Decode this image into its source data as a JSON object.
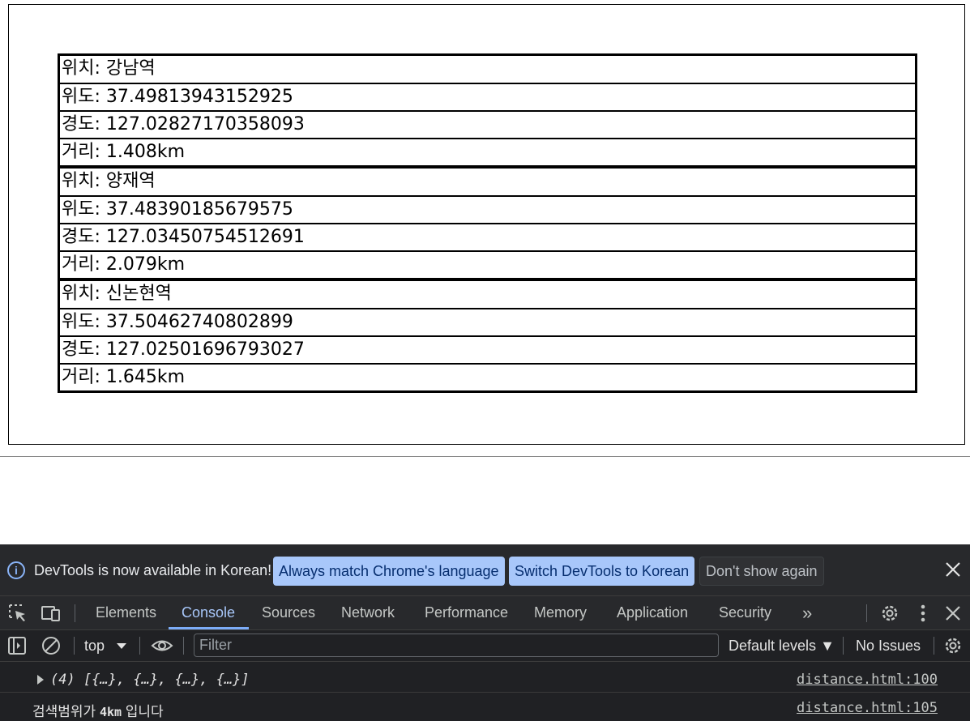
{
  "page": {
    "stations": [
      {
        "location": "위치: 강남역",
        "latitude": "위도: 37.49813943152925",
        "longitude": "경도: 127.02827170358093",
        "distance": "거리: 1.408km"
      },
      {
        "location": "위치: 양재역",
        "latitude": "위도: 37.48390185679575",
        "longitude": "경도: 127.03450754512691",
        "distance": "거리: 2.079km"
      },
      {
        "location": "위치: 신논현역",
        "latitude": "위도: 37.50462740802899",
        "longitude": "경도: 127.02501696793027",
        "distance": "거리: 1.645km"
      }
    ]
  },
  "devtools": {
    "infobar": {
      "message": "DevTools is now available in Korean!",
      "always_match": "Always match Chrome's language",
      "switch": "Switch DevTools to Korean",
      "dont_show": "Don't show again"
    },
    "tabs": [
      {
        "label": "Elements",
        "active": false
      },
      {
        "label": "Console",
        "active": true
      },
      {
        "label": "Sources",
        "active": false
      },
      {
        "label": "Network",
        "active": false
      },
      {
        "label": "Performance",
        "active": false
      },
      {
        "label": "Memory",
        "active": false
      },
      {
        "label": "Application",
        "active": false
      },
      {
        "label": "Security",
        "active": false
      }
    ],
    "more_tabs": "»",
    "toolbar": {
      "context": "top",
      "filter_placeholder": "Filter",
      "levels": "Default levels",
      "issues": "No Issues"
    },
    "console": [
      {
        "text": "(4) [{…}, {…}, {…}, {…}]",
        "source": "distance.html:100"
      },
      {
        "text_prefix": "검색범위가 ",
        "text_bold": "4km",
        "text_suffix": " 입니다",
        "source": "distance.html:105"
      }
    ],
    "colors": {
      "background": "#202124",
      "accent": "#a8c7fa",
      "active_tab": "#7cacf8"
    },
    "icons": [
      "info-icon",
      "close-icon",
      "inspect-icon",
      "device-toggle-icon",
      "settings-icon",
      "more-vert-icon",
      "sidebar-toggle-icon",
      "clear-console-icon",
      "dropdown-arrow-icon",
      "eye-icon"
    ]
  }
}
